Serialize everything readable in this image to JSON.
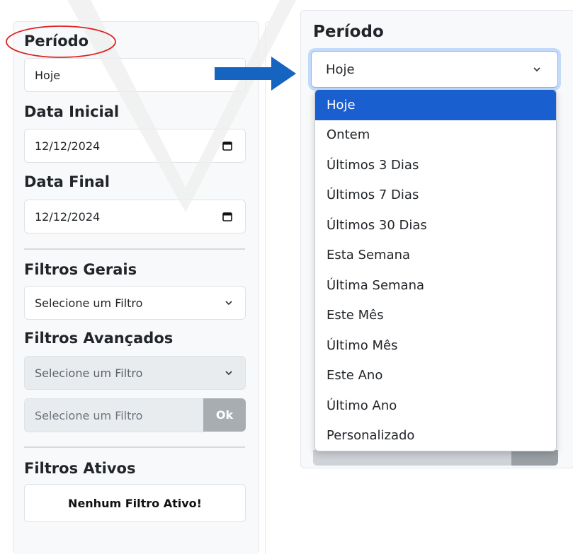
{
  "colors": {
    "accent": "#1a5fd0",
    "arrow": "#1565c0",
    "annotation_oval": "#e02020",
    "focus_border": "#86b7fe",
    "disabled_bg": "#e9ecef"
  },
  "left_panel": {
    "periodo": {
      "label": "Período",
      "value": "Hoje"
    },
    "data_inicial": {
      "label": "Data Inicial",
      "value": "12/12/2024",
      "icon": "calendar-icon"
    },
    "data_final": {
      "label": "Data Final",
      "value": "12/12/2024",
      "icon": "calendar-icon"
    },
    "filtros_gerais": {
      "label": "Filtros Gerais",
      "select_value": "Selecione um Filtro"
    },
    "filtros_avancados": {
      "label": "Filtros Avançados",
      "select_value": "Selecione um Filtro",
      "input_placeholder": "Selecione um Filtro",
      "ok_label": "Ok"
    },
    "filtros_ativos": {
      "label": "Filtros Ativos",
      "empty_message": "Nenhum Filtro Ativo!"
    }
  },
  "right_panel": {
    "periodo_label": "Período",
    "select_value": "Hoje",
    "options": [
      "Hoje",
      "Ontem",
      "Últimos 3 Dias",
      "Últimos 7 Dias",
      "Últimos 30 Dias",
      "Esta Semana",
      "Última Semana",
      "Este Mês",
      "Último Mês",
      "Este Ano",
      "Último Ano",
      "Personalizado"
    ],
    "selected_index": 0
  }
}
